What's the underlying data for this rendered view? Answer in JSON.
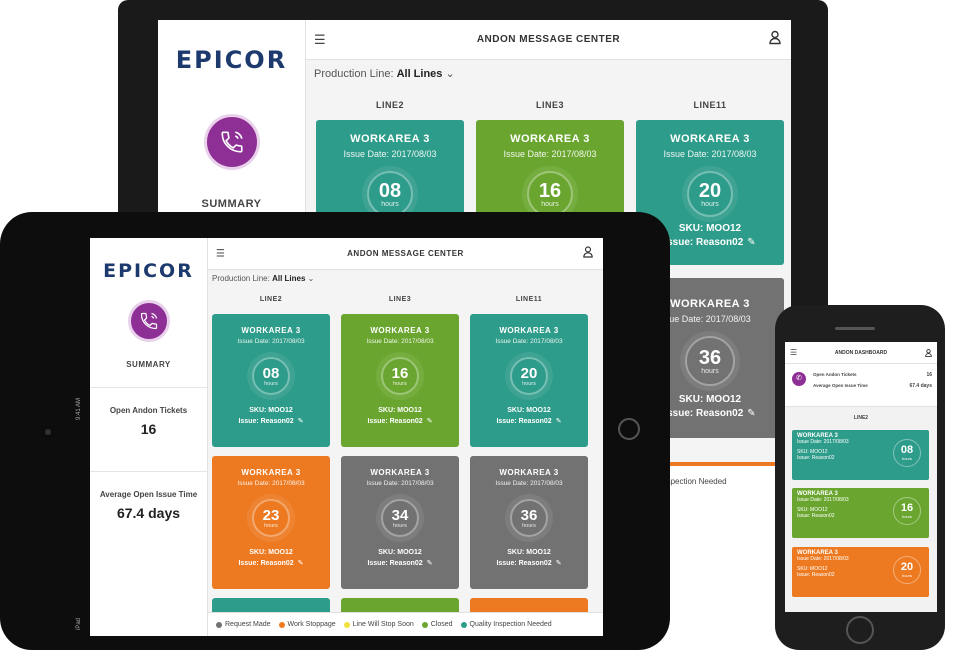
{
  "app": {
    "logo": "EPICOR",
    "title": "ANDON MESSAGE CENTER",
    "summary_label": "SUMMARY",
    "filter_label": "Production Line:",
    "filter_value": "All Lines",
    "columns": [
      "LINE2",
      "LINE3",
      "LINE11"
    ],
    "stats": {
      "open_tickets_label": "Open Andon Tickets",
      "open_tickets_value": "16",
      "avg_time_label": "Average Open Issue Time",
      "avg_time_value": "67.4 days"
    },
    "hours_label": "hours"
  },
  "cards_row1": [
    {
      "workarea": "WORKAREA 3",
      "date": "Issue Date: 2017/08/03",
      "hours": "08",
      "sku": "SKU: MOO12",
      "issue": "Issue: Reason02",
      "color": "#2e9c8a"
    },
    {
      "workarea": "WORKAREA 3",
      "date": "Issue Date: 2017/08/03",
      "hours": "16",
      "sku": "SKU: MOO12",
      "issue": "Issue: Reason02",
      "color": "#6aa62f"
    },
    {
      "workarea": "WORKAREA 3",
      "date": "Issue Date: 2017/08/03",
      "hours": "20",
      "sku": "SKU: MOO12",
      "issue": "Issue: Reason02",
      "color": "#2e9c8a"
    }
  ],
  "cards_row2": [
    {
      "workarea": "WORKAREA 3",
      "date": "Issue Date: 2017/08/03",
      "hours": "23",
      "sku": "SKU: MOO12",
      "issue": "Issue: Reason02",
      "color": "#ed7a21"
    },
    {
      "workarea": "WORKAREA 3",
      "date": "Issue Date: 2017/08/03",
      "hours": "34",
      "sku": "SKU: MOO12",
      "issue": "Issue: Reason02",
      "color": "#727272"
    },
    {
      "workarea": "WORKAREA 3",
      "date": "Issue Date: 2017/08/03",
      "hours": "36",
      "sku": "SKU: MOO12",
      "issue": "Issue: Reason02",
      "color": "#727272"
    }
  ],
  "legend": [
    {
      "label": "Request Made",
      "color": "#727272"
    },
    {
      "label": "Work Stoppage",
      "color": "#ed7a21"
    },
    {
      "label": "Line Will Stop Soon",
      "color": "#f2e13b"
    },
    {
      "label": "Closed",
      "color": "#6aa62f"
    },
    {
      "label": "Quality Inspection Needed",
      "color": "#2e9c8a"
    }
  ],
  "laptop_extra": {
    "gray_card": {
      "workarea": "WORKAREA 3",
      "date": "ue Date: 2017/08/03",
      "hours": "36",
      "sku": "SKU: MOO12",
      "issue": "Issue: Reason02"
    },
    "legend_fragment": "uality Inspection Needed"
  },
  "phone": {
    "title": "ANDON DASHBOARD",
    "open_tickets_label": "Open Andon Tickets",
    "open_tickets_value": "16",
    "avg_time_label": "Average Open Issue Time",
    "avg_time_value": "67.4 days",
    "column": "LINE2",
    "cards": [
      {
        "workarea": "WORKAREA 3",
        "date": "Issue Date: 2017/08/03",
        "sku": "SKU: MOO12",
        "issue": "Issue: Reason02",
        "hours": "08",
        "color": "#2e9c8a"
      },
      {
        "workarea": "WORKAREA 3",
        "date": "Issue Date: 2017/08/03",
        "sku": "SKU: MOO12",
        "issue": "Issue: Reason02",
        "hours": "16",
        "color": "#6aa62f"
      },
      {
        "workarea": "WORKAREA 3",
        "date": "Issue Date: 2017/08/03",
        "sku": "SKU: MOO12",
        "issue": "Issue: Reason02",
        "hours": "20",
        "color": "#ed7a21"
      }
    ]
  },
  "tablet_status": {
    "carrier": "iPad",
    "time": "9:41 AM"
  },
  "icons": {
    "menu": "menu-icon",
    "user": "user-icon",
    "summary": "phone-call-icon",
    "chevron": "chevron-down-icon",
    "edit": "pencil-icon"
  }
}
